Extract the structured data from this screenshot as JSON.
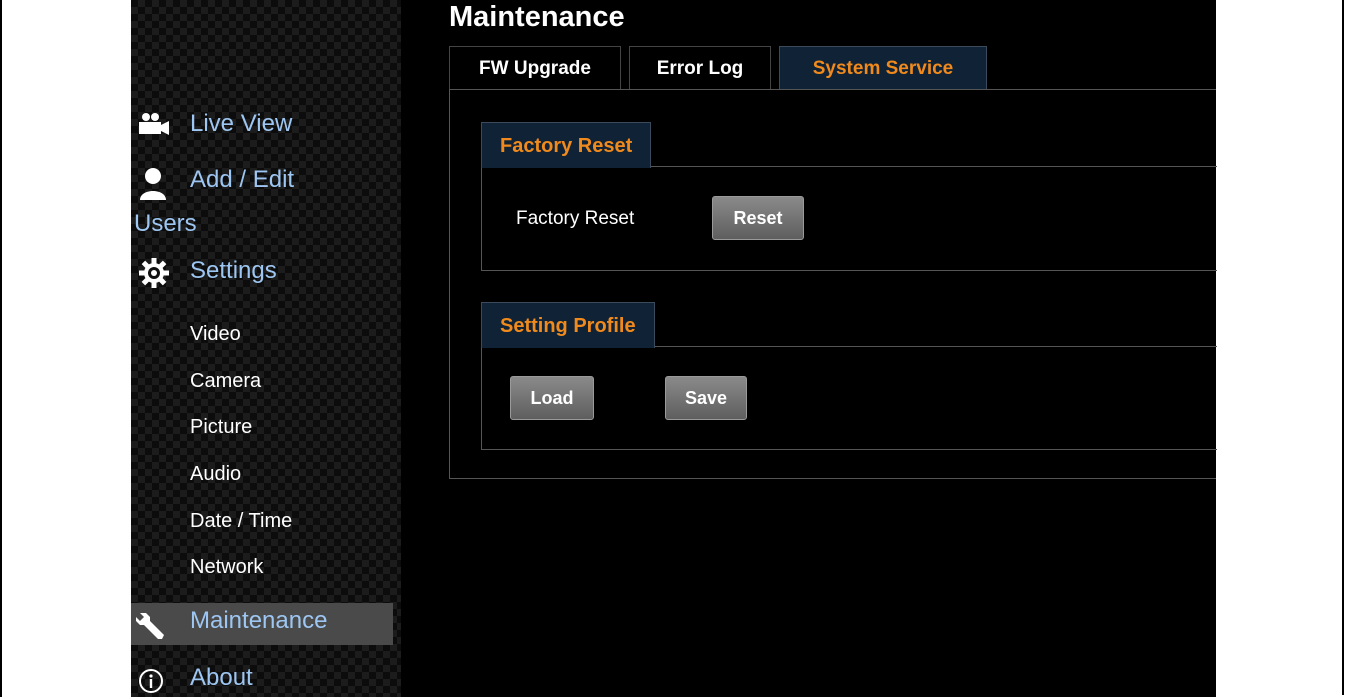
{
  "sidebar": {
    "items": [
      {
        "label": "Live View",
        "icon": "camera-icon"
      },
      {
        "label": "Add / Edit",
        "label2": "Users",
        "icon": "user-icon"
      },
      {
        "label": "Settings",
        "icon": "gear-icon"
      },
      {
        "label": "Maintenance",
        "icon": "wrench-icon",
        "active": true
      },
      {
        "label": "About",
        "icon": "info-icon"
      }
    ],
    "sub_items": [
      "Video",
      "Camera",
      "Picture",
      "Audio",
      "Date / Time",
      "Network"
    ]
  },
  "main": {
    "title": "Maintenance",
    "tabs": [
      {
        "label": "FW Upgrade",
        "active": false
      },
      {
        "label": "Error Log",
        "active": false
      },
      {
        "label": "System Service",
        "active": true
      }
    ],
    "factory_reset": {
      "title": "Factory Reset",
      "label": "Factory Reset",
      "button": "Reset"
    },
    "setting_profile": {
      "title": "Setting Profile",
      "load_button": "Load",
      "save_button": "Save"
    }
  },
  "colors": {
    "accent_orange": "#f08a1c",
    "nav_blue": "#9ec6f2",
    "active_tab_bg": "#0f2236"
  }
}
